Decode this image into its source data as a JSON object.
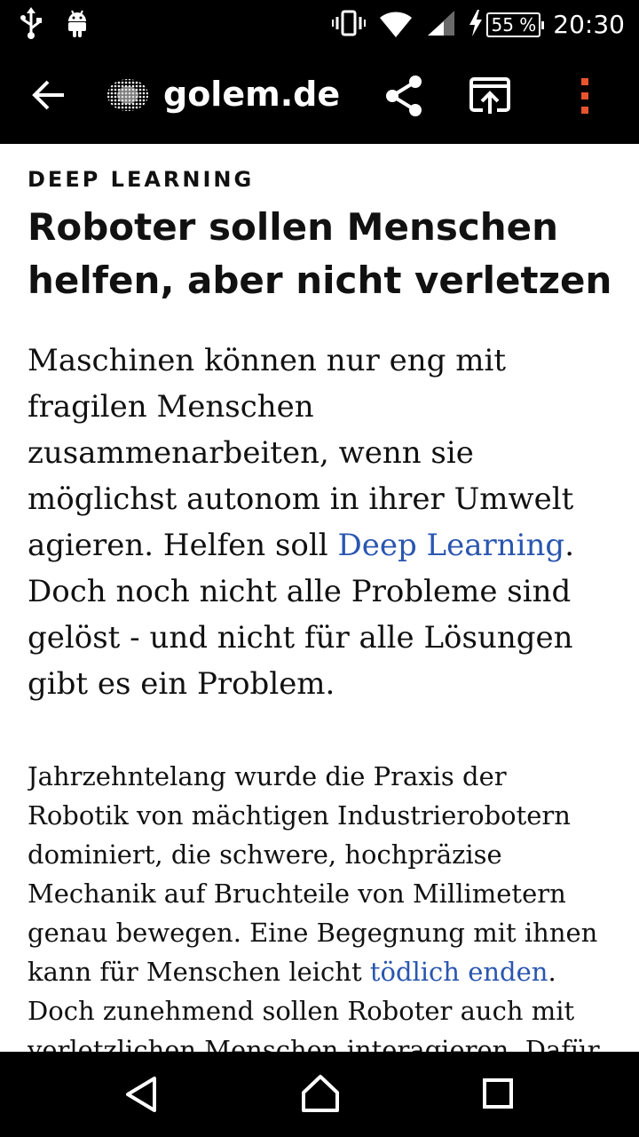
{
  "status_bar": {
    "icons": [
      "usb-icon",
      "android-debug-icon",
      "vibrate-icon",
      "wifi-icon",
      "signal-icon",
      "charging-icon"
    ],
    "battery": "55 %",
    "time": "20:30"
  },
  "app_bar": {
    "site": "golem.de",
    "icons": [
      "back-arrow-icon",
      "golem-logo-icon",
      "share-icon",
      "open-in-browser-icon",
      "overflow-menu-icon"
    ],
    "accent": "#e8542f"
  },
  "article": {
    "kicker": "DEEP LEARNING",
    "headline": "Roboter sollen Menschen helfen, aber nicht verletzen",
    "lead": {
      "before": "Maschinen können nur eng mit fragilen Menschen zusammenarbeiten, wenn sie möglichst autonom in ihrer Umwelt agieren. Helfen soll ",
      "link": "Deep Learning",
      "after": ". Doch noch nicht alle Probleme sind gelöst - und nicht für alle Lösungen gibt es ein Problem."
    },
    "body": {
      "before": "Jahrzehntelang wurde die Praxis der Robotik von mächtigen Industrierobotern dominiert, die schwere, hochpräzise Mechanik auf Bruchteile von Millimetern genau bewegen. Eine Begegnung mit ihnen kann für Menschen leicht ",
      "link": "tödlich enden",
      "after": ". Doch zunehmend sollen Roboter auch mit verletzlichen Menschen interagieren. Dafür müssen sie nicht nur leichter gestaltet"
    },
    "link_color": "#2a56b0"
  },
  "nav_bar": {
    "icons": [
      "nav-back-icon",
      "nav-home-icon",
      "nav-recents-icon"
    ]
  }
}
